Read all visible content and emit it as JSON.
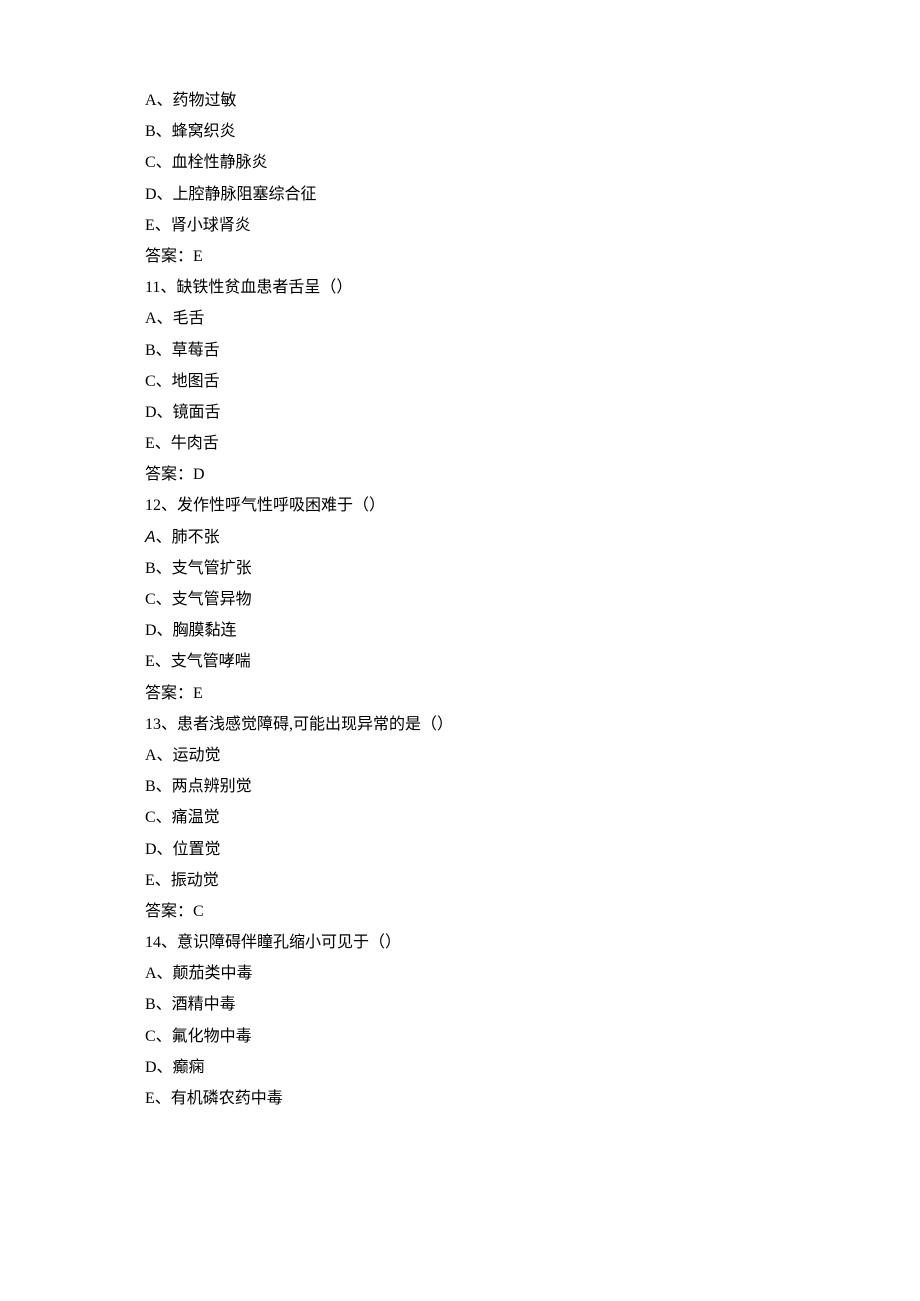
{
  "partial_question_options": [
    "A、药物过敏",
    "B、蜂窝织炎",
    "C、血栓性静脉炎",
    "D、上腔静脉阻塞综合征",
    "E、肾小球肾炎"
  ],
  "partial_question_answer": "答案：E",
  "questions": [
    {
      "number": "11",
      "stem": "11、缺铁性贫血患者舌呈（）",
      "options": [
        "A、毛舌",
        "B、草莓舌",
        "C、地图舌",
        "D、镜面舌",
        "E、牛肉舌"
      ],
      "answer": "答案：D"
    },
    {
      "number": "12",
      "stem": "12、发作性呼气性呼吸困难于（）",
      "options": [
        {
          "prefix_italic": "A",
          "rest": "、肺不张"
        },
        "B、支气管扩张",
        "C、支气管异物",
        "D、胸膜黏连",
        "E、支气管哮喘"
      ],
      "answer": "答案：E"
    },
    {
      "number": "13",
      "stem": "13、患者浅感觉障碍,可能出现异常的是（）",
      "options": [
        "A、运动觉",
        "B、两点辨别觉",
        "C、痛温觉",
        "D、位置觉",
        "E、振动觉"
      ],
      "answer": "答案：C"
    },
    {
      "number": "14",
      "stem": "14、意识障碍伴瞳孔缩小可见于（）",
      "options": [
        "A、颠茄类中毒",
        "B、酒精中毒",
        "C、氟化物中毒",
        "D、癫痫",
        "E、有机磷农药中毒"
      ],
      "answer": null
    }
  ]
}
